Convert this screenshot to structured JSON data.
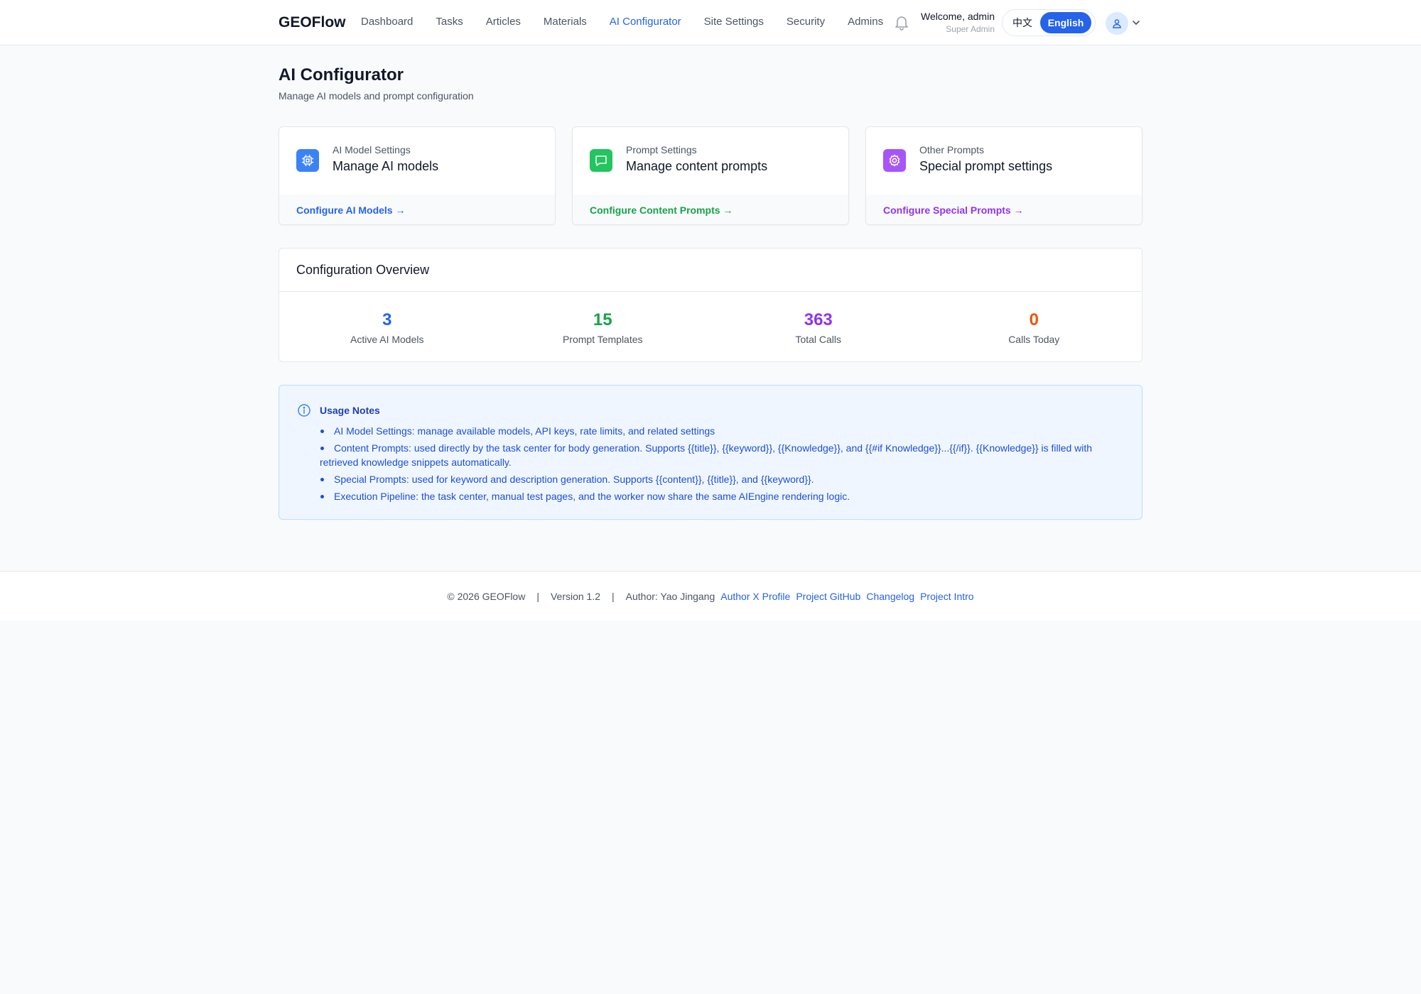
{
  "header": {
    "brand": "GEOFlow",
    "nav": [
      {
        "label": "Dashboard",
        "active": false
      },
      {
        "label": "Tasks",
        "active": false
      },
      {
        "label": "Articles",
        "active": false
      },
      {
        "label": "Materials",
        "active": false
      },
      {
        "label": "AI Configurator",
        "active": true
      },
      {
        "label": "Site Settings",
        "active": false
      },
      {
        "label": "Security",
        "active": false
      },
      {
        "label": "Admins",
        "active": false
      }
    ],
    "welcome": "Welcome, admin",
    "role": "Super Admin",
    "lang_zh": "中文",
    "lang_en": "English",
    "icons": {
      "bell": "bell-icon",
      "avatar": "user-icon",
      "menu": "chevron-down-icon"
    }
  },
  "page": {
    "title": "AI Configurator",
    "subtitle": "Manage AI models and prompt configuration"
  },
  "cards": [
    {
      "label": "AI Model Settings",
      "title": "Manage AI models",
      "link": "Configure AI Models →",
      "color": "#2563eb",
      "icon_bg": "#3b82f6",
      "icon": "cpu-chip-icon"
    },
    {
      "label": "Prompt Settings",
      "title": "Manage content prompts",
      "link": "Configure Content Prompts →",
      "color": "#16a34a",
      "icon_bg": "#22c55e",
      "icon": "chat-bubble-icon"
    },
    {
      "label": "Other Prompts",
      "title": "Special prompt settings",
      "link": "Configure Special Prompts →",
      "color": "#9333ea",
      "icon_bg": "#a855f7",
      "icon": "gear-icon"
    }
  ],
  "overview": {
    "title": "Configuration Overview",
    "stats": [
      {
        "value": "3",
        "label": "Active AI Models",
        "color": "#2563eb"
      },
      {
        "value": "15",
        "label": "Prompt Templates",
        "color": "#16a34a"
      },
      {
        "value": "363",
        "label": "Total Calls",
        "color": "#9333ea"
      },
      {
        "value": "0",
        "label": "Calls Today",
        "color": "#ea580c"
      }
    ]
  },
  "notes": {
    "title": "Usage Notes",
    "icon": "info-circle-icon",
    "items": [
      "AI Model Settings: manage available models, API keys, rate limits, and related settings",
      "Content Prompts: used directly by the task center for body generation. Supports {{title}}, {{keyword}}, {{Knowledge}}, and {{#if Knowledge}}...{{/if}}. {{Knowledge}} is filled with retrieved knowledge snippets automatically.",
      "Special Prompts: used for keyword and description generation. Supports {{content}}, {{title}}, and {{keyword}}.",
      "Execution Pipeline: the task center, manual test pages, and the worker now share the same AIEngine rendering logic."
    ]
  },
  "footer": {
    "copyright": "© 2026 GEOFlow",
    "separator": "|",
    "version": "Version 1.2",
    "author": "Author: Yao Jingang",
    "links": [
      "Author X Profile",
      "Project GitHub",
      "Changelog",
      "Project Intro"
    ]
  }
}
